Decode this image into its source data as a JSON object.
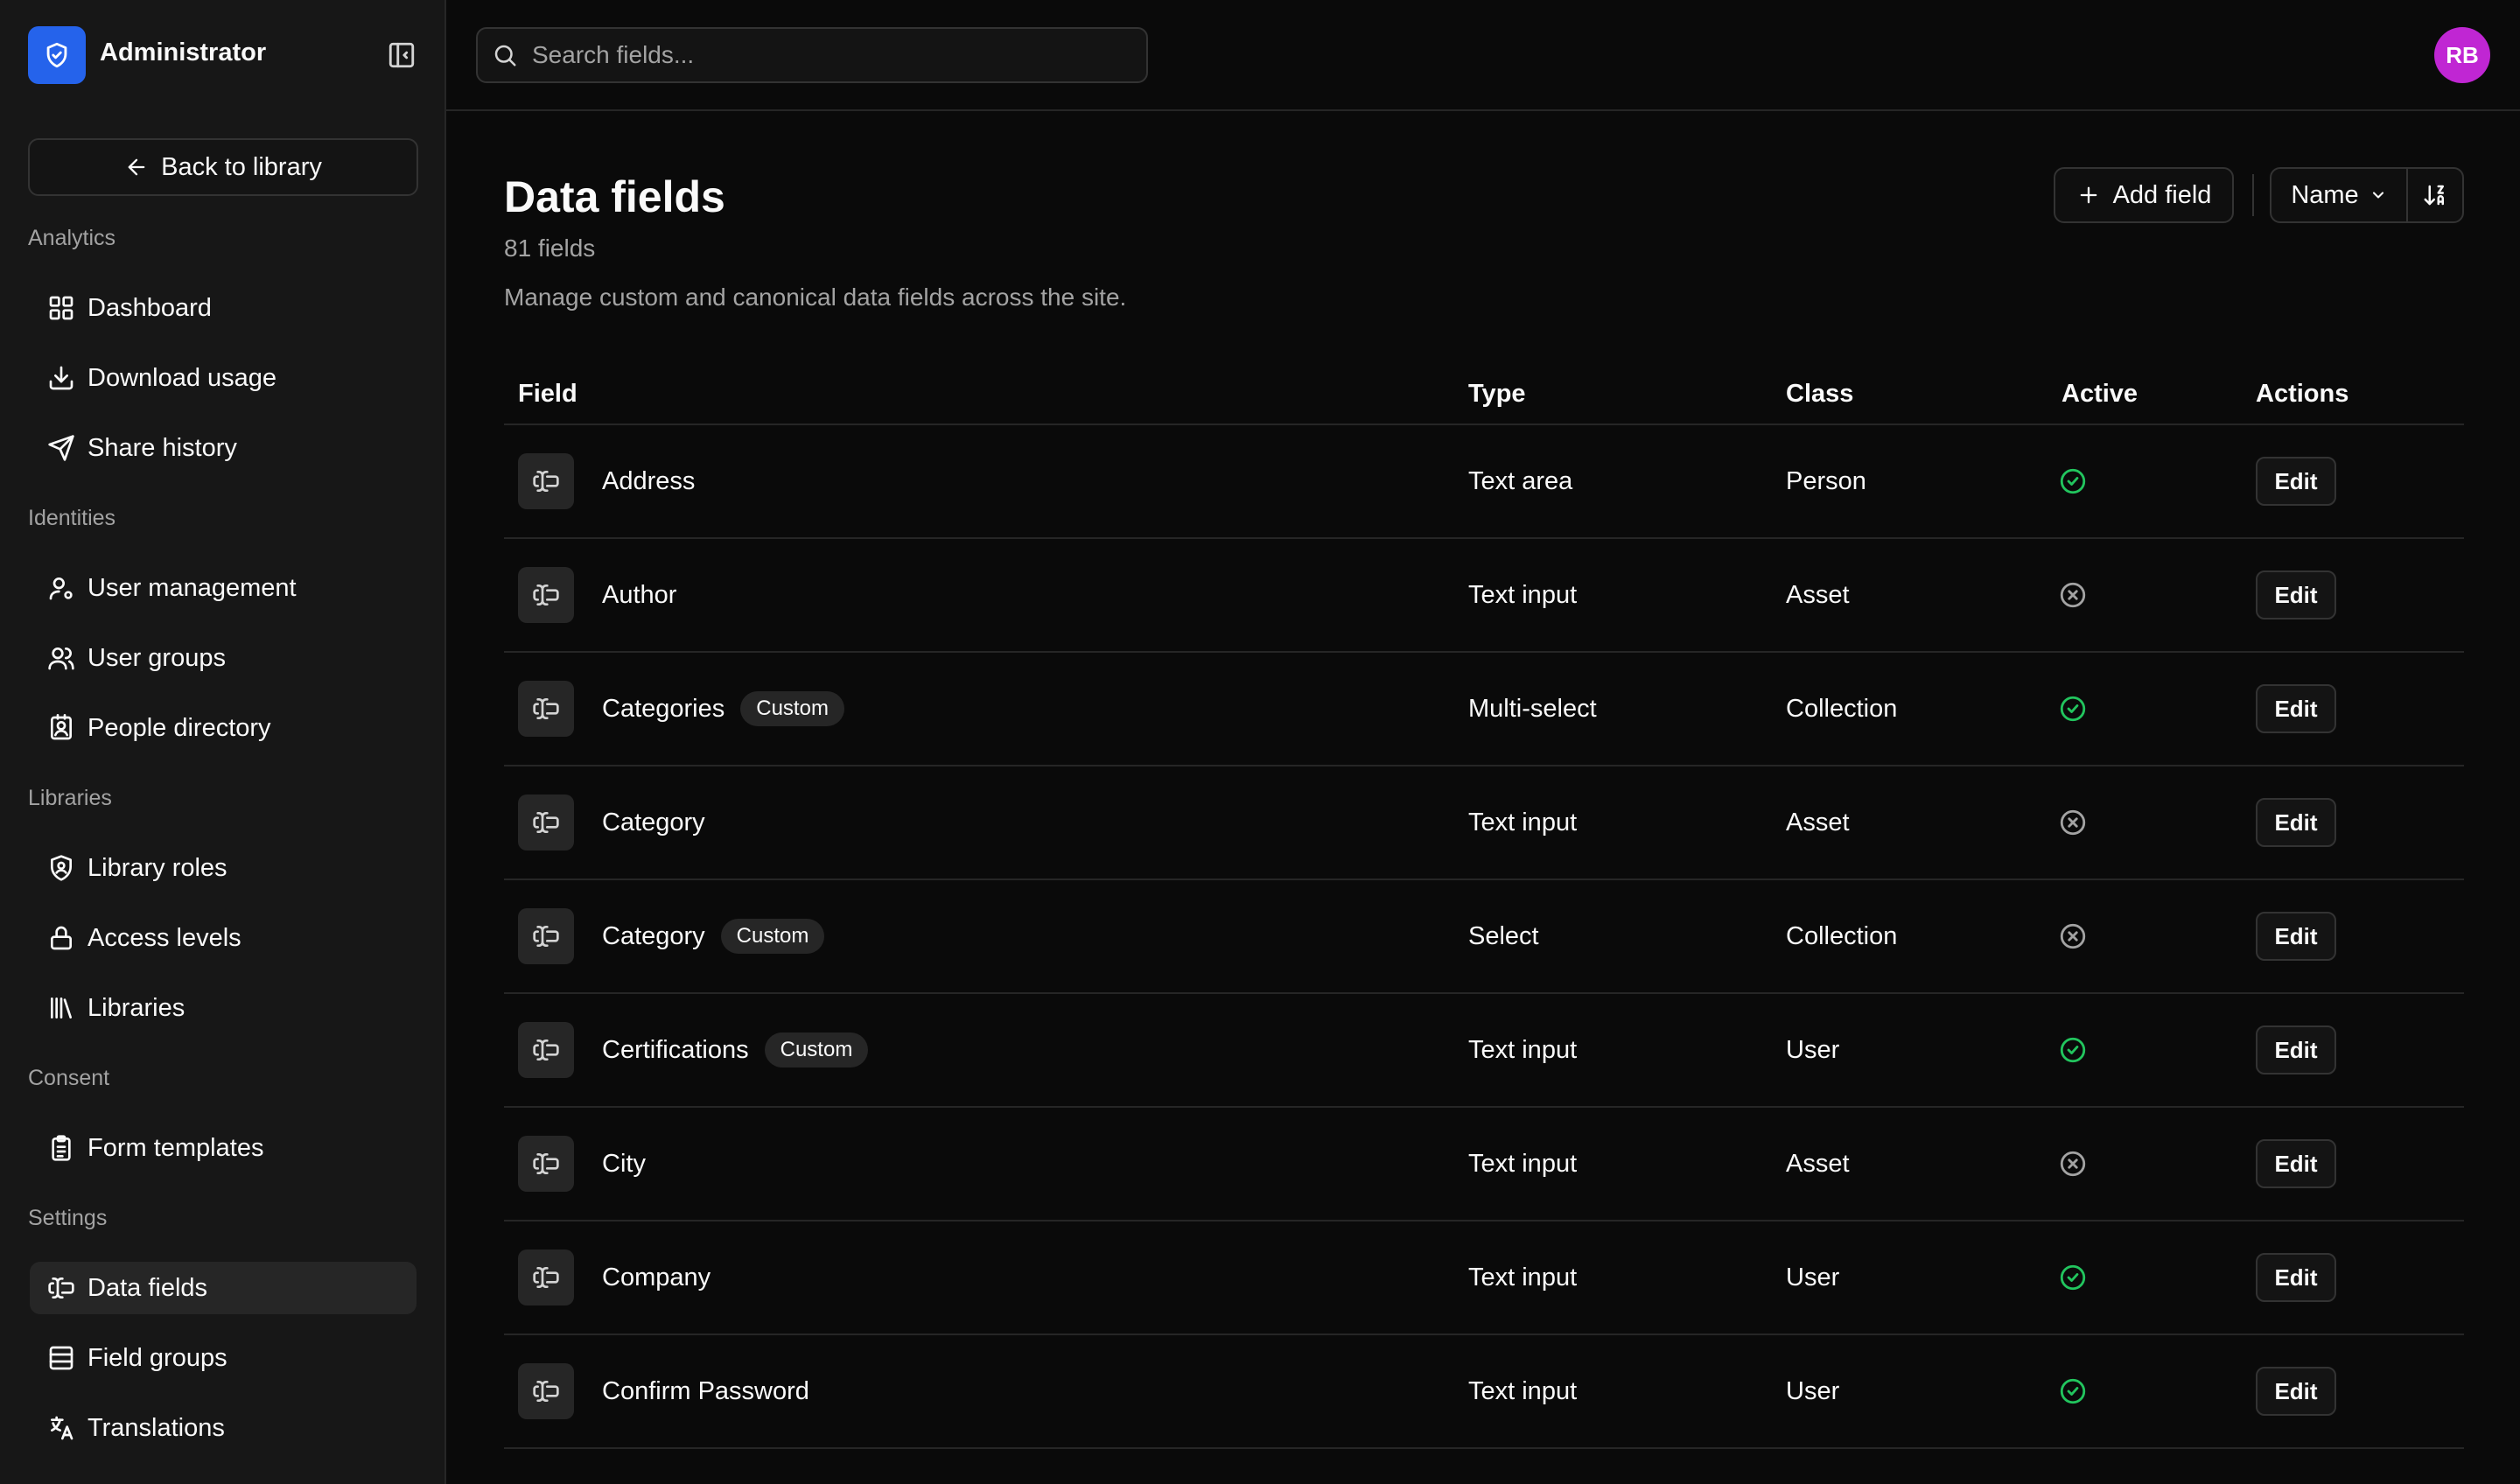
{
  "sidebar": {
    "brand": "Administrator",
    "back_label": "Back to library",
    "sections": [
      {
        "title": "Analytics",
        "items": [
          {
            "label": "Dashboard",
            "icon": "dashboard-icon"
          },
          {
            "label": "Download usage",
            "icon": "download-icon"
          },
          {
            "label": "Share history",
            "icon": "send-icon"
          }
        ]
      },
      {
        "title": "Identities",
        "items": [
          {
            "label": "User management",
            "icon": "user-cog-icon"
          },
          {
            "label": "User groups",
            "icon": "users-icon"
          },
          {
            "label": "People directory",
            "icon": "contact-icon"
          }
        ]
      },
      {
        "title": "Libraries",
        "items": [
          {
            "label": "Library roles",
            "icon": "shield-user-icon"
          },
          {
            "label": "Access levels",
            "icon": "lock-icon"
          },
          {
            "label": "Libraries",
            "icon": "library-icon"
          }
        ]
      },
      {
        "title": "Consent",
        "items": [
          {
            "label": "Form templates",
            "icon": "clipboard-icon"
          }
        ]
      },
      {
        "title": "Settings",
        "items": [
          {
            "label": "Data fields",
            "icon": "text-cursor-input-icon",
            "active": true
          },
          {
            "label": "Field groups",
            "icon": "table-icon"
          },
          {
            "label": "Translations",
            "icon": "languages-icon"
          }
        ]
      }
    ]
  },
  "search": {
    "placeholder": "Search fields..."
  },
  "user": {
    "initials": "RB",
    "avatar_color": "#c026d3"
  },
  "page": {
    "title": "Data fields",
    "count": "81 fields",
    "description": "Manage custom and canonical data fields across the site."
  },
  "toolbar": {
    "add_label": "Add field",
    "sort_label": "Name"
  },
  "table": {
    "headers": {
      "field": "Field",
      "type": "Type",
      "class": "Class",
      "active": "Active",
      "actions": "Actions"
    },
    "edit_label": "Edit",
    "rows": [
      {
        "name": "Address",
        "badge": "",
        "type": "Text area",
        "class": "Person",
        "active": true
      },
      {
        "name": "Author",
        "badge": "",
        "type": "Text input",
        "class": "Asset",
        "active": false
      },
      {
        "name": "Categories",
        "badge": "Custom",
        "type": "Multi-select",
        "class": "Collection",
        "active": true
      },
      {
        "name": "Category",
        "badge": "",
        "type": "Text input",
        "class": "Asset",
        "active": false
      },
      {
        "name": "Category",
        "badge": "Custom",
        "type": "Select",
        "class": "Collection",
        "active": false
      },
      {
        "name": "Certifications",
        "badge": "Custom",
        "type": "Text input",
        "class": "User",
        "active": true
      },
      {
        "name": "City",
        "badge": "",
        "type": "Text input",
        "class": "Asset",
        "active": false
      },
      {
        "name": "Company",
        "badge": "",
        "type": "Text input",
        "class": "User",
        "active": true
      },
      {
        "name": "Confirm Password",
        "badge": "",
        "type": "Text input",
        "class": "User",
        "active": true
      }
    ]
  },
  "colors": {
    "brand": "#2563eb",
    "active": "#22c55e",
    "inactive": "#a3a3a3"
  }
}
